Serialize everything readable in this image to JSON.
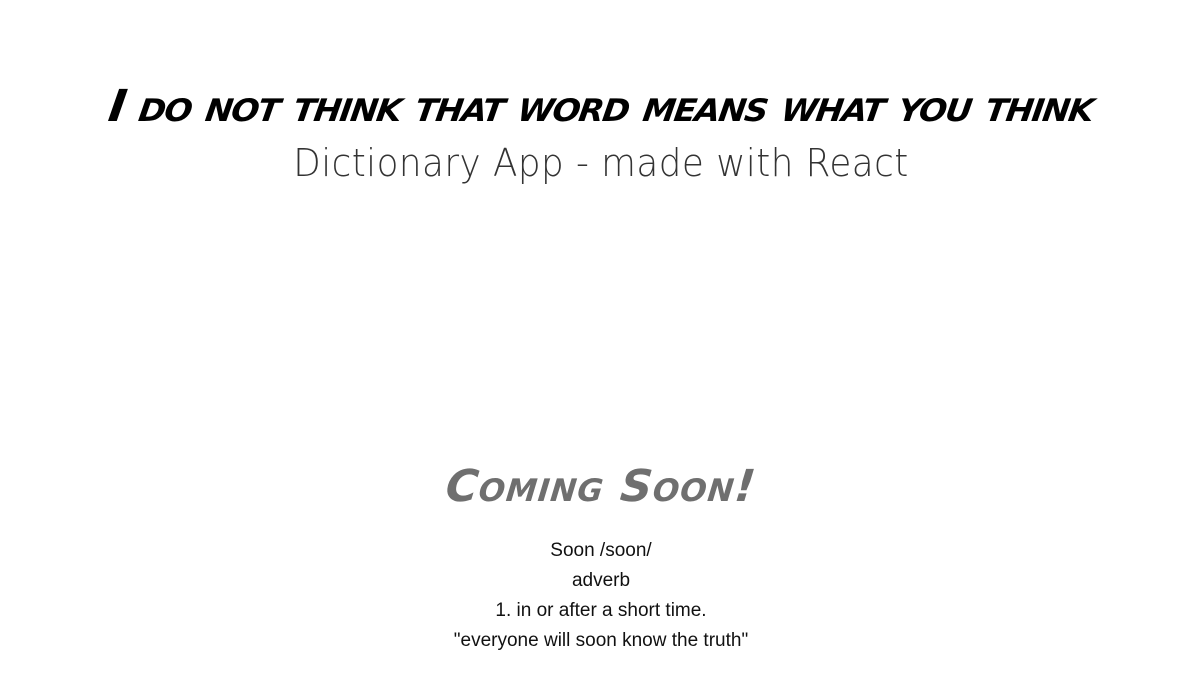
{
  "header": {
    "title": "I do not think that word means what you think",
    "subtitle": "Dictionary App - made with React"
  },
  "main": {
    "coming_soon": "Coming Soon!",
    "definition": {
      "word_line": "Soon /soon/",
      "part_of_speech": "adverb",
      "meaning": "1. in or after a short time.",
      "example": "\"everyone will soon know the truth\""
    }
  }
}
